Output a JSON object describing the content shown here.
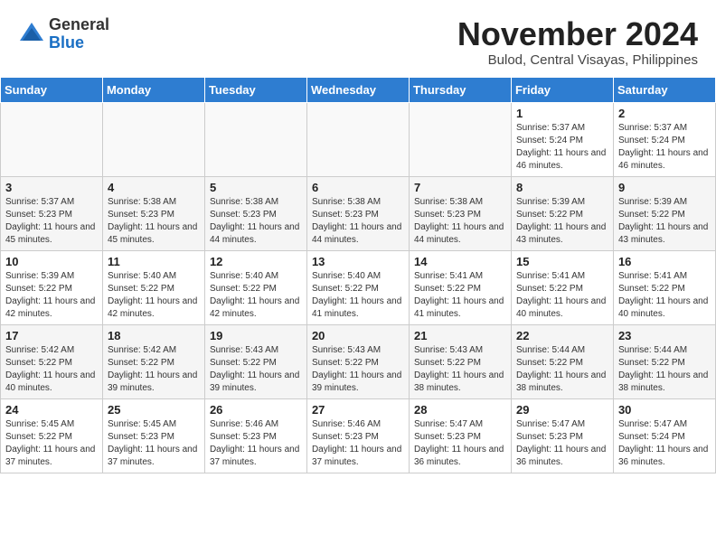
{
  "logo": {
    "general": "General",
    "blue": "Blue"
  },
  "title": "November 2024",
  "subtitle": "Bulod, Central Visayas, Philippines",
  "days_of_week": [
    "Sunday",
    "Monday",
    "Tuesday",
    "Wednesday",
    "Thursday",
    "Friday",
    "Saturday"
  ],
  "weeks": [
    [
      {
        "day": "",
        "info": ""
      },
      {
        "day": "",
        "info": ""
      },
      {
        "day": "",
        "info": ""
      },
      {
        "day": "",
        "info": ""
      },
      {
        "day": "",
        "info": ""
      },
      {
        "day": "1",
        "info": "Sunrise: 5:37 AM\nSunset: 5:24 PM\nDaylight: 11 hours and 46 minutes."
      },
      {
        "day": "2",
        "info": "Sunrise: 5:37 AM\nSunset: 5:24 PM\nDaylight: 11 hours and 46 minutes."
      }
    ],
    [
      {
        "day": "3",
        "info": "Sunrise: 5:37 AM\nSunset: 5:23 PM\nDaylight: 11 hours and 45 minutes."
      },
      {
        "day": "4",
        "info": "Sunrise: 5:38 AM\nSunset: 5:23 PM\nDaylight: 11 hours and 45 minutes."
      },
      {
        "day": "5",
        "info": "Sunrise: 5:38 AM\nSunset: 5:23 PM\nDaylight: 11 hours and 44 minutes."
      },
      {
        "day": "6",
        "info": "Sunrise: 5:38 AM\nSunset: 5:23 PM\nDaylight: 11 hours and 44 minutes."
      },
      {
        "day": "7",
        "info": "Sunrise: 5:38 AM\nSunset: 5:23 PM\nDaylight: 11 hours and 44 minutes."
      },
      {
        "day": "8",
        "info": "Sunrise: 5:39 AM\nSunset: 5:22 PM\nDaylight: 11 hours and 43 minutes."
      },
      {
        "day": "9",
        "info": "Sunrise: 5:39 AM\nSunset: 5:22 PM\nDaylight: 11 hours and 43 minutes."
      }
    ],
    [
      {
        "day": "10",
        "info": "Sunrise: 5:39 AM\nSunset: 5:22 PM\nDaylight: 11 hours and 42 minutes."
      },
      {
        "day": "11",
        "info": "Sunrise: 5:40 AM\nSunset: 5:22 PM\nDaylight: 11 hours and 42 minutes."
      },
      {
        "day": "12",
        "info": "Sunrise: 5:40 AM\nSunset: 5:22 PM\nDaylight: 11 hours and 42 minutes."
      },
      {
        "day": "13",
        "info": "Sunrise: 5:40 AM\nSunset: 5:22 PM\nDaylight: 11 hours and 41 minutes."
      },
      {
        "day": "14",
        "info": "Sunrise: 5:41 AM\nSunset: 5:22 PM\nDaylight: 11 hours and 41 minutes."
      },
      {
        "day": "15",
        "info": "Sunrise: 5:41 AM\nSunset: 5:22 PM\nDaylight: 11 hours and 40 minutes."
      },
      {
        "day": "16",
        "info": "Sunrise: 5:41 AM\nSunset: 5:22 PM\nDaylight: 11 hours and 40 minutes."
      }
    ],
    [
      {
        "day": "17",
        "info": "Sunrise: 5:42 AM\nSunset: 5:22 PM\nDaylight: 11 hours and 40 minutes."
      },
      {
        "day": "18",
        "info": "Sunrise: 5:42 AM\nSunset: 5:22 PM\nDaylight: 11 hours and 39 minutes."
      },
      {
        "day": "19",
        "info": "Sunrise: 5:43 AM\nSunset: 5:22 PM\nDaylight: 11 hours and 39 minutes."
      },
      {
        "day": "20",
        "info": "Sunrise: 5:43 AM\nSunset: 5:22 PM\nDaylight: 11 hours and 39 minutes."
      },
      {
        "day": "21",
        "info": "Sunrise: 5:43 AM\nSunset: 5:22 PM\nDaylight: 11 hours and 38 minutes."
      },
      {
        "day": "22",
        "info": "Sunrise: 5:44 AM\nSunset: 5:22 PM\nDaylight: 11 hours and 38 minutes."
      },
      {
        "day": "23",
        "info": "Sunrise: 5:44 AM\nSunset: 5:22 PM\nDaylight: 11 hours and 38 minutes."
      }
    ],
    [
      {
        "day": "24",
        "info": "Sunrise: 5:45 AM\nSunset: 5:22 PM\nDaylight: 11 hours and 37 minutes."
      },
      {
        "day": "25",
        "info": "Sunrise: 5:45 AM\nSunset: 5:23 PM\nDaylight: 11 hours and 37 minutes."
      },
      {
        "day": "26",
        "info": "Sunrise: 5:46 AM\nSunset: 5:23 PM\nDaylight: 11 hours and 37 minutes."
      },
      {
        "day": "27",
        "info": "Sunrise: 5:46 AM\nSunset: 5:23 PM\nDaylight: 11 hours and 37 minutes."
      },
      {
        "day": "28",
        "info": "Sunrise: 5:47 AM\nSunset: 5:23 PM\nDaylight: 11 hours and 36 minutes."
      },
      {
        "day": "29",
        "info": "Sunrise: 5:47 AM\nSunset: 5:23 PM\nDaylight: 11 hours and 36 minutes."
      },
      {
        "day": "30",
        "info": "Sunrise: 5:47 AM\nSunset: 5:24 PM\nDaylight: 11 hours and 36 minutes."
      }
    ]
  ]
}
